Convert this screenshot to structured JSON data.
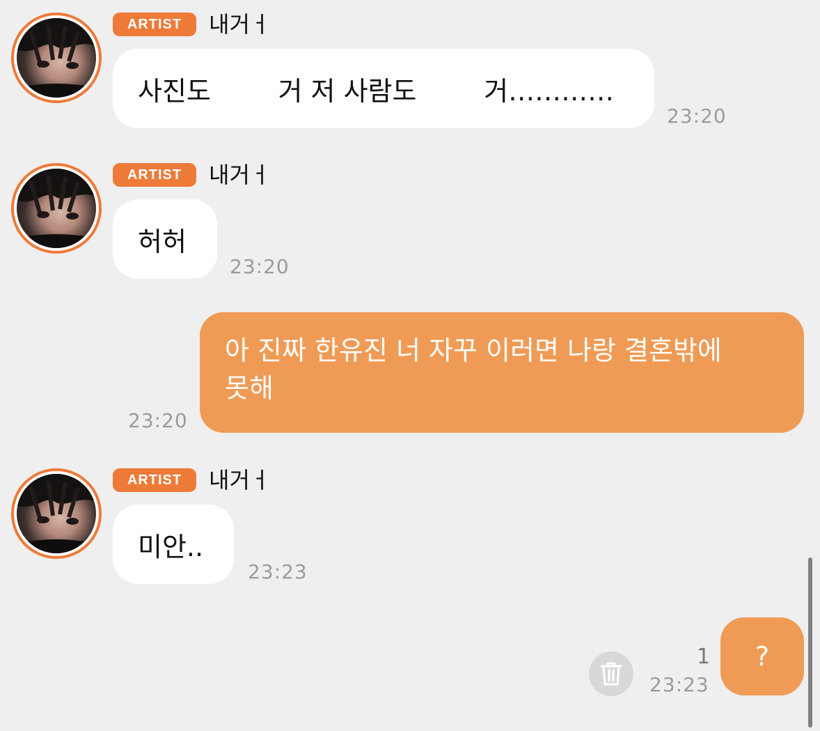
{
  "colors": {
    "background": "#efefef",
    "accent": "#ee7a38",
    "outgoing_bubble": "#f09b55",
    "incoming_bubble": "#ffffff",
    "timestamp": "#9b9b9b"
  },
  "messages": [
    {
      "direction": "incoming",
      "badge": "ARTIST",
      "sender": "내거ㅓ",
      "text": "사진도        거 저 사람도        거…………",
      "time": "23:20"
    },
    {
      "direction": "incoming",
      "badge": "ARTIST",
      "sender": "내거ㅓ",
      "text": "허허",
      "time": "23:20"
    },
    {
      "direction": "outgoing",
      "text_line1": "아 진짜 한유진 너 자꾸 이러면 나랑 결혼밖에",
      "text_line2": "못해",
      "time": "23:20"
    },
    {
      "direction": "incoming",
      "badge": "ARTIST",
      "sender": "내거ㅓ",
      "text": "미안..",
      "time": "23:23"
    },
    {
      "direction": "outgoing",
      "text": "?",
      "unread_count": "1",
      "time": "23:23",
      "delete_icon": "trash-icon"
    }
  ]
}
